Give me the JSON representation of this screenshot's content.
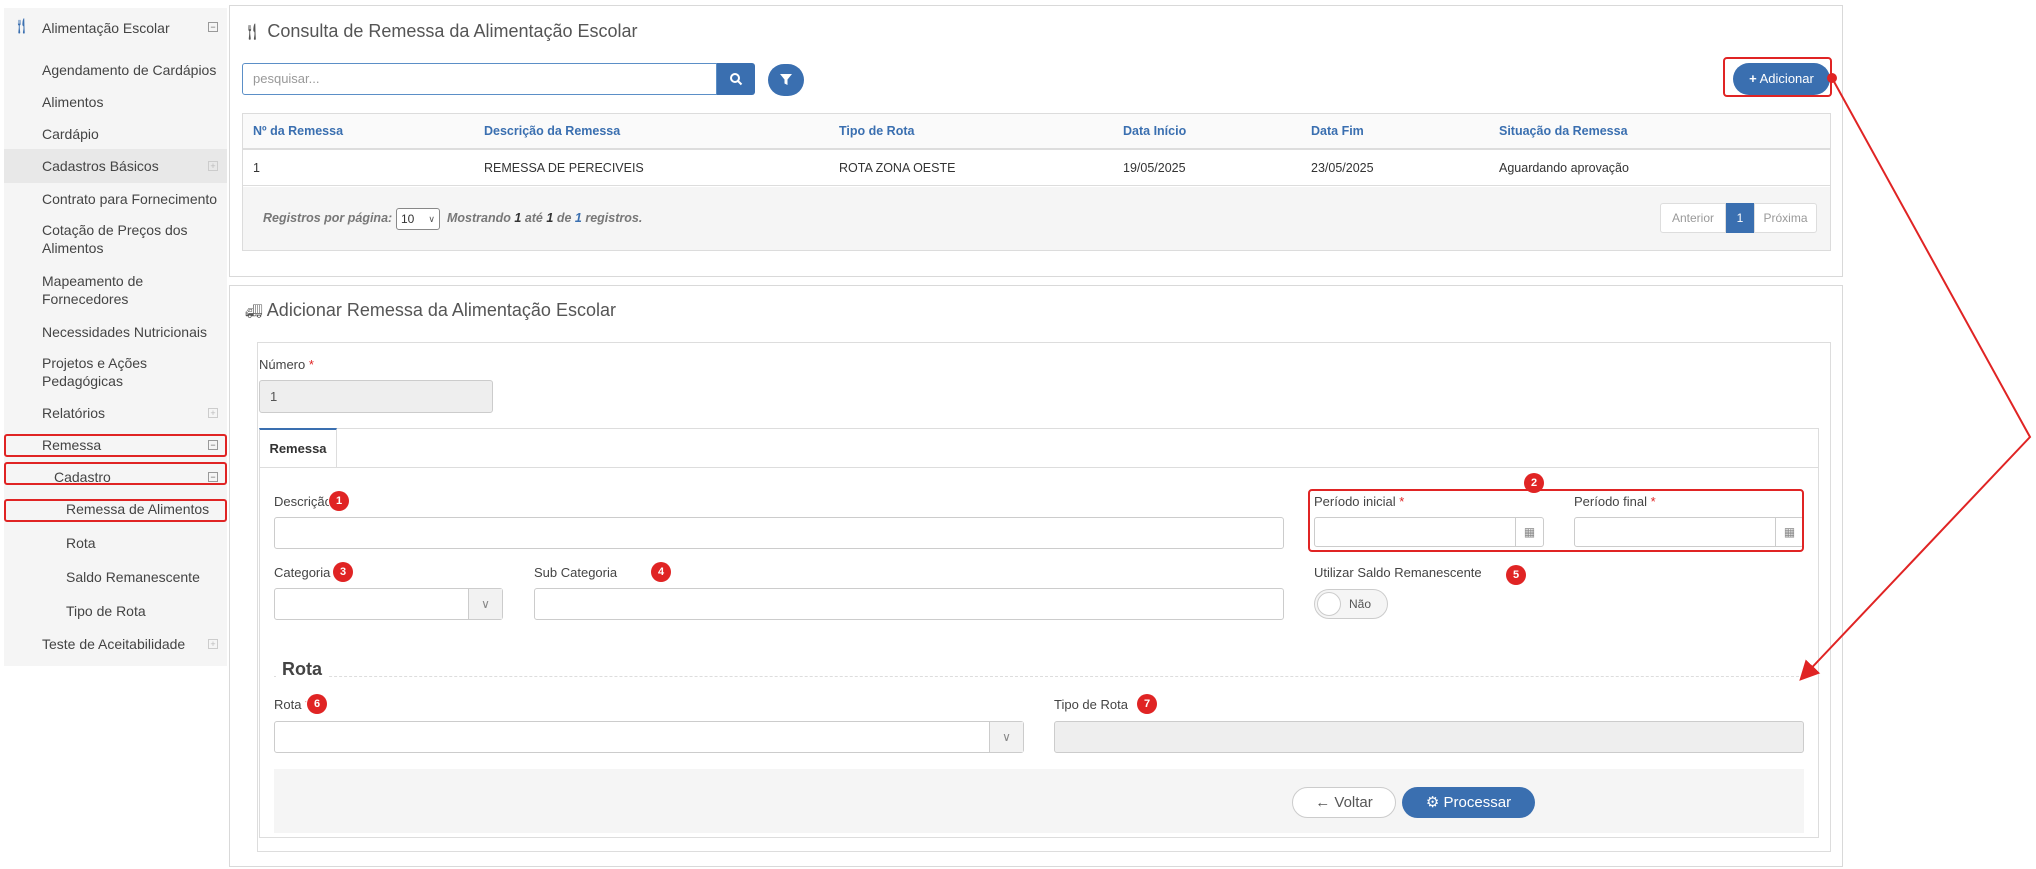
{
  "sidebar": {
    "header": "Alimentação Escolar",
    "items": [
      {
        "label": "Agendamento de Cardápios"
      },
      {
        "label": "Alimentos"
      },
      {
        "label": "Cardápio"
      },
      {
        "label": "Cadastros Básicos"
      },
      {
        "label": "Contrato para Fornecimento"
      },
      {
        "label": "Cotação de Preços dos Alimentos"
      },
      {
        "label": "Mapeamento de Fornecedores"
      },
      {
        "label": "Necessidades Nutricionais"
      },
      {
        "label": "Projetos e Ações Pedagógicas"
      },
      {
        "label": "Relatórios"
      },
      {
        "label": "Remessa"
      },
      {
        "label": "Cadastro"
      },
      {
        "label": "Remessa de Alimentos"
      },
      {
        "label": "Rota"
      },
      {
        "label": "Saldo Remanescente"
      },
      {
        "label": "Tipo de Rota"
      },
      {
        "label": "Teste de Aceitabilidade"
      }
    ]
  },
  "consulta": {
    "title": "Consulta de Remessa da Alimentação Escolar",
    "search_placeholder": "pesquisar...",
    "add_label": "Adicionar",
    "columns": [
      "Nº da Remessa",
      "Descrição da Remessa",
      "Tipo de Rota",
      "Data Início",
      "Data Fim",
      "Situação da Remessa"
    ],
    "rows": [
      [
        "1",
        "REMESSA DE PERECIVEIS",
        "ROTA ZONA OESTE",
        "19/05/2025",
        "23/05/2025",
        "Aguardando aprovação"
      ]
    ],
    "per_page_label": "Registros por página:",
    "per_page_value": "10",
    "showing_prefix": "Mostrando",
    "showing_from": "1",
    "showing_mid": "até",
    "showing_to": "1",
    "showing_of": "de",
    "showing_total": "1",
    "showing_suffix": "registros.",
    "prev_label": "Anterior",
    "page_current": "1",
    "next_label": "Próxima"
  },
  "form": {
    "title": "Adicionar Remessa da Alimentação Escolar",
    "numero_label": "Número",
    "numero_value": "1",
    "tab_label": "Remessa",
    "descricao_label": "Descrição",
    "periodo_inicial_label": "Período inicial",
    "periodo_final_label": "Período final",
    "categoria_label": "Categoria",
    "sub_categoria_label": "Sub Categoria",
    "saldo_label": "Utilizar Saldo Remanescente",
    "saldo_toggle": "Não",
    "rota_section": "Rota",
    "rota_label": "Rota",
    "tipo_rota_label": "Tipo de Rota",
    "voltar_label": "Voltar",
    "processar_label": "Processar",
    "required_mark": "*"
  },
  "badges": [
    "1",
    "2",
    "3",
    "4",
    "5",
    "6",
    "7"
  ],
  "colors": {
    "primary": "#3a6fb0",
    "highlight": "#e02424"
  }
}
